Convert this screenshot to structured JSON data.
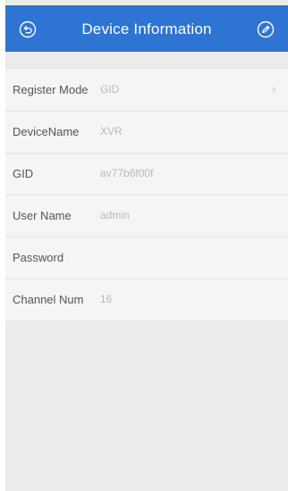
{
  "header": {
    "title": "Device Information",
    "back_icon": "back-arrow-icon",
    "edit_icon": "edit-pencil-icon",
    "color": "#2e74d2"
  },
  "fields": [
    {
      "label": "Register Mode",
      "value": "GID"
    },
    {
      "label": "DeviceName",
      "value": "XVR"
    },
    {
      "label": "GID",
      "value": "av77b6f00f"
    },
    {
      "label": "User Name",
      "value": "admin"
    },
    {
      "label": "Password",
      "value": ""
    },
    {
      "label": "Channel Num",
      "value": "16"
    }
  ],
  "chevron": "›"
}
